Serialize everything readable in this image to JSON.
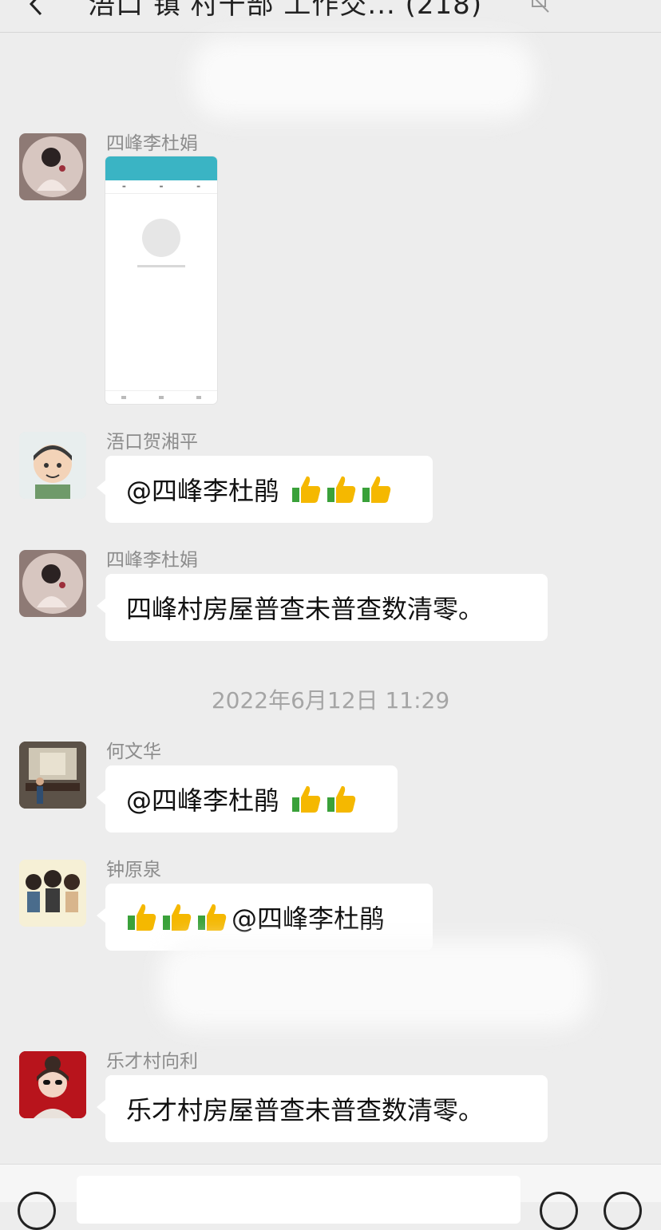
{
  "header": {
    "title": "浯口 镇 村干部 工作交... (218)"
  },
  "messages": [
    {
      "sender": "四峰李杜娟",
      "type": "image"
    },
    {
      "sender": "浯口贺湘平",
      "text": "@四峰李杜鹃",
      "thumbs": 3
    },
    {
      "sender": "四峰李杜娟",
      "text": "四峰村房屋普查未普查数清零。"
    },
    {
      "sender": "何文华",
      "text": "@四峰李杜鹃",
      "thumbs": 2
    },
    {
      "sender": "钟原泉",
      "text": "@四峰李杜鹃",
      "thumbs": 3
    },
    {
      "sender": "乐才村向利",
      "text": "乐才村房屋普查未普查数清零。"
    }
  ],
  "timestamp": "2022年6月12日 11:29",
  "icons": {
    "back": "chevron-left-icon",
    "mute": "bell-mute-icon",
    "thumb": "thumbs-up-icon"
  },
  "colors": {
    "background": "#ededed",
    "bubble": "#ffffff",
    "sender": "#8c8c8c",
    "timestamp": "#a5a5a5"
  }
}
